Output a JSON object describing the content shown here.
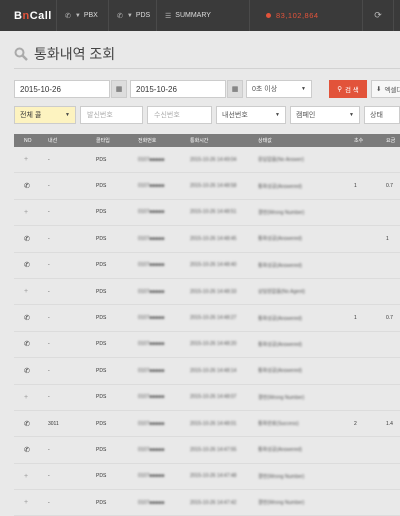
{
  "app": {
    "logo_b": "B",
    "logo_n": "n",
    "logo_rest": "Call"
  },
  "nav": [
    {
      "label": "PBX",
      "icon": "phone-icon"
    },
    {
      "label": "PDS",
      "icon": "phone-icon"
    },
    {
      "label": "SUMMARY",
      "icon": "list-icon"
    }
  ],
  "balance": "83,102,864",
  "page_title": "통화내역 조회",
  "filters": {
    "date_from": "2015-10-26",
    "date_to": "2015-10-26",
    "duration": "0초 이상",
    "search_label": "검 색",
    "excel_label": "엑셀다운",
    "type_select": "전체 콜",
    "caller_placeholder": "발신번호",
    "callee_placeholder": "수신번호",
    "extension_select": "내선번호",
    "campaign_select": "캠페인",
    "status_select": "상태"
  },
  "table": {
    "headers": [
      "NO",
      "내선",
      "콜타입",
      "전화번호",
      "통화시간",
      "상태값",
      "초수",
      "요금"
    ],
    "rows": [
      {
        "icon": "plus",
        "ext": "-",
        "type": "PDS",
        "phone": "0107■■■■■",
        "time": "2015-10-26 14:49:04",
        "status": "응답없음(No Answer)",
        "dur": "",
        "fee": ""
      },
      {
        "icon": "phone",
        "ext": "-",
        "type": "PDS",
        "phone": "0107■■■■■",
        "time": "2015-10-26 14:48:58",
        "status": "통화성공(Answered)",
        "dur": "1",
        "fee": "0.7"
      },
      {
        "icon": "plus",
        "ext": "-",
        "type": "PDS",
        "phone": "0107■■■■■",
        "time": "2015-10-26 14:48:51",
        "status": "결번(Wrong Number)",
        "dur": "",
        "fee": ""
      },
      {
        "icon": "phone",
        "ext": "-",
        "type": "PDS",
        "phone": "0107■■■■■",
        "time": "2015-10-26 14:48:45",
        "status": "통화성공(Answered)",
        "dur": "",
        "fee": "1"
      },
      {
        "icon": "phone",
        "ext": "-",
        "type": "PDS",
        "phone": "0107■■■■■",
        "time": "2015-10-26 14:48:40",
        "status": "통화성공(Answered)",
        "dur": "",
        "fee": ""
      },
      {
        "icon": "plus",
        "ext": "-",
        "type": "PDS",
        "phone": "0107■■■■■",
        "time": "2015-10-26 14:48:33",
        "status": "상담원없음(No Agent)",
        "dur": "",
        "fee": ""
      },
      {
        "icon": "phone",
        "ext": "-",
        "type": "PDS",
        "phone": "0107■■■■■",
        "time": "2015-10-26 14:48:27",
        "status": "통화성공(Answered)",
        "dur": "1",
        "fee": "0.7"
      },
      {
        "icon": "phone",
        "ext": "-",
        "type": "PDS",
        "phone": "0107■■■■■",
        "time": "2015-10-26 14:48:20",
        "status": "통화성공(Answered)",
        "dur": "",
        "fee": ""
      },
      {
        "icon": "phone",
        "ext": "-",
        "type": "PDS",
        "phone": "0107■■■■■",
        "time": "2015-10-26 14:48:14",
        "status": "통화성공(Answered)",
        "dur": "",
        "fee": ""
      },
      {
        "icon": "plus",
        "ext": "-",
        "type": "PDS",
        "phone": "0107■■■■■",
        "time": "2015-10-26 14:48:07",
        "status": "결번(Wrong Number)",
        "dur": "",
        "fee": ""
      },
      {
        "icon": "phone",
        "ext": "3011",
        "type": "PDS",
        "phone": "0107■■■■■",
        "time": "2015-10-26 14:48:01",
        "status": "통화완료(Success)",
        "dur": "2",
        "fee": "1.4"
      },
      {
        "icon": "phone",
        "ext": "-",
        "type": "PDS",
        "phone": "0107■■■■■",
        "time": "2015-10-26 14:47:55",
        "status": "통화성공(Answered)",
        "dur": "",
        "fee": ""
      },
      {
        "icon": "plus",
        "ext": "-",
        "type": "PDS",
        "phone": "0107■■■■■",
        "time": "2015-10-26 14:47:48",
        "status": "결번(Wrong Number)",
        "dur": "",
        "fee": ""
      },
      {
        "icon": "plus",
        "ext": "-",
        "type": "PDS",
        "phone": "0107■■■■■",
        "time": "2015-10-26 14:47:42",
        "status": "결번(Wrong Number)",
        "dur": "",
        "fee": ""
      }
    ]
  },
  "colors": {
    "accent": "#e2533a",
    "topbar": "#3a3a3a",
    "header": "#7b7b7b",
    "highlight": "#fdf3c0"
  }
}
